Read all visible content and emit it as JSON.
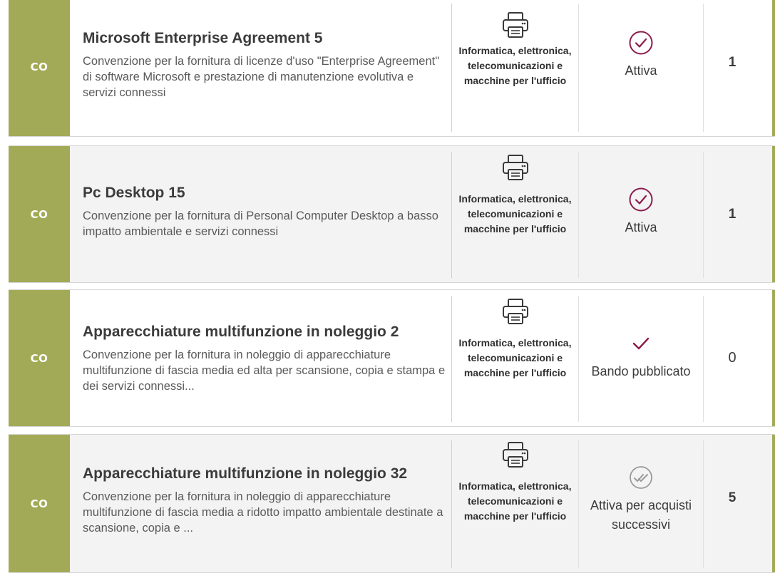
{
  "rows": [
    {
      "code": "CO",
      "title": "Microsoft Enterprise Agreement 5",
      "desc": "Convenzione per la fornitura di licenze d'uso \"Enterprise Agreement\" di software Microsoft e prestazione di manutenzione evolutiva e servizi connessi",
      "category": "Informatica, elettronica, telecomunicazioni e macchine per l'ufficio",
      "category_icon": "printer-icon",
      "status": "Attiva",
      "status_icon": "check-circle-icon",
      "count": "1"
    },
    {
      "code": "CO",
      "title": "Pc Desktop 15",
      "desc": "Convenzione per la fornitura di Personal Computer Desktop a basso impatto ambientale e servizi connessi",
      "category": "Informatica, elettronica, telecomunicazioni e macchine per l'ufficio",
      "category_icon": "printer-icon",
      "status": "Attiva",
      "status_icon": "check-circle-icon",
      "count": "1"
    },
    {
      "code": "CO",
      "title": "Apparecchiature multifunzione in noleggio 2",
      "desc": "Convenzione per la fornitura in noleggio di apparecchiature multifunzione di fascia media ed alta per scansione, copia e stampa e dei servizi connessi...",
      "category": "Informatica, elettronica, telecomunicazioni e macchine per l'ufficio",
      "category_icon": "printer-icon",
      "status": "Bando pubblicato",
      "status_icon": "check-icon",
      "count": "0"
    },
    {
      "code": "CO",
      "title": "Apparecchiature multifunzione in noleggio 32",
      "desc": "Convenzione per la fornitura in noleggio di apparecchiature multifunzione di fascia media a ridotto impatto ambientale destinate a scansione, copia e ...",
      "category": "Informatica, elettronica, telecomunicazioni e macchine per l'ufficio",
      "category_icon": "printer-icon",
      "status": "Attiva per acquisti successivi",
      "status_icon": "double-check-circle-icon",
      "count": "5"
    }
  ],
  "colors": {
    "accent": "#a3aa57",
    "status_active": "#8b1d4c",
    "status_inactive": "#9a9a9a"
  }
}
